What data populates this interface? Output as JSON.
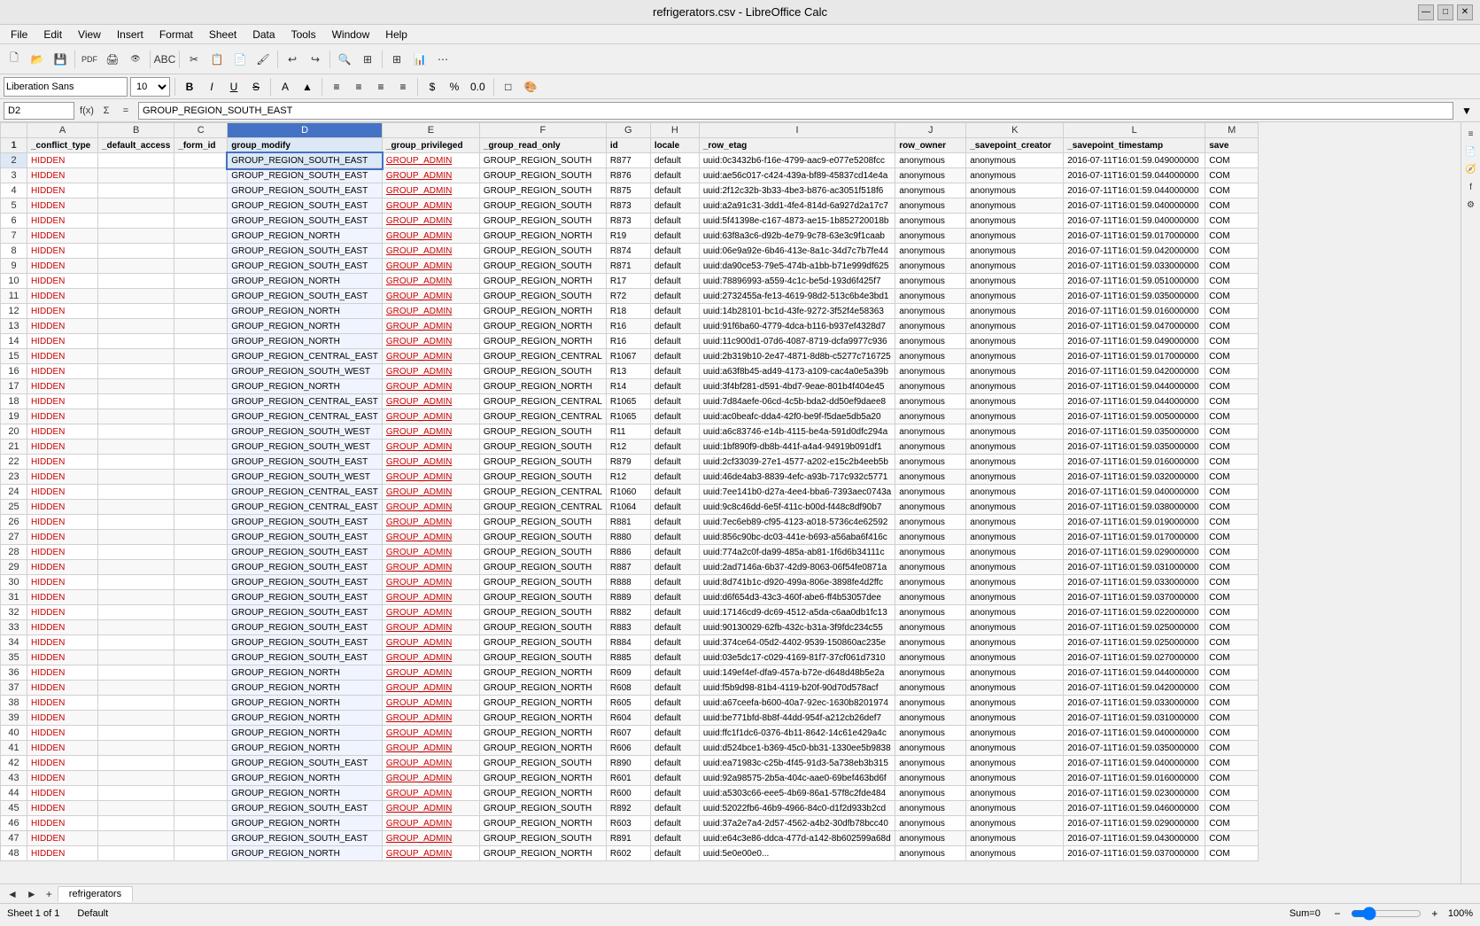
{
  "title": "refrigerators.csv - LibreOffice Calc",
  "titleBar": {
    "title": "refrigerators.csv - LibreOffice Calc",
    "minimizeLabel": "—",
    "maximizeLabel": "□",
    "closeLabel": "✕"
  },
  "menuBar": {
    "items": [
      "File",
      "Edit",
      "View",
      "Insert",
      "Format",
      "Sheet",
      "Data",
      "Tools",
      "Window",
      "Help"
    ]
  },
  "formatBar": {
    "fontName": "Liberation Sans",
    "fontSize": "10",
    "boldLabel": "B",
    "italicLabel": "I",
    "underlineLabel": "U"
  },
  "formulaBar": {
    "cellRef": "D2",
    "formula": "GROUP_REGION_SOUTH_EAST"
  },
  "columns": [
    {
      "id": "A",
      "label": "A",
      "header": "_conflict_type"
    },
    {
      "id": "B",
      "label": "B",
      "header": "_default_access"
    },
    {
      "id": "C",
      "label": "C",
      "header": "_form_id"
    },
    {
      "id": "D",
      "label": "D",
      "header": "group_modify"
    },
    {
      "id": "E",
      "label": "E",
      "header": "_group_privileged"
    },
    {
      "id": "F",
      "label": "F",
      "header": "_group_read_only"
    },
    {
      "id": "G",
      "label": "G",
      "header": "id"
    },
    {
      "id": "H",
      "label": "H",
      "header": "locale"
    },
    {
      "id": "I",
      "label": "I",
      "header": "_row_etag"
    },
    {
      "id": "J",
      "label": "J",
      "header": "row_owner"
    },
    {
      "id": "K",
      "label": "K",
      "header": "_savepoint_creator"
    },
    {
      "id": "L",
      "label": "L",
      "header": "_savepoint_timestamp"
    },
    {
      "id": "M",
      "label": "M",
      "header": "save"
    }
  ],
  "rows": [
    {
      "num": 2,
      "A": "HIDDEN",
      "B": "",
      "C": "",
      "D": "GROUP_REGION_SOUTH_EAST",
      "E": "GROUP_ADMIN",
      "F": "GROUP_REGION_SOUTH",
      "G": "R877",
      "H": "default",
      "I": "uuid:0c3432b6-f16e-4799-aac9-e077e5208fcc",
      "J": "anonymous",
      "K": "anonymous",
      "L": "2016-07-11T16:01:59.049000000",
      "M": "COM"
    },
    {
      "num": 3,
      "A": "HIDDEN",
      "B": "",
      "C": "",
      "D": "GROUP_REGION_SOUTH_EAST",
      "E": "GROUP_ADMIN",
      "F": "GROUP_REGION_SOUTH",
      "G": "R876",
      "H": "default",
      "I": "uuid:ae56c017-c424-439a-bf89-45837cd14e4a",
      "J": "anonymous",
      "K": "anonymous",
      "L": "2016-07-11T16:01:59.044000000",
      "M": "COM"
    },
    {
      "num": 4,
      "A": "HIDDEN",
      "B": "",
      "C": "",
      "D": "GROUP_REGION_SOUTH_EAST",
      "E": "GROUP_ADMIN",
      "F": "GROUP_REGION_SOUTH",
      "G": "R875",
      "H": "default",
      "I": "uuid:2f12c32b-3b33-4be3-b876-ac3051f518f6",
      "J": "anonymous",
      "K": "anonymous",
      "L": "2016-07-11T16:01:59.044000000",
      "M": "COM"
    },
    {
      "num": 5,
      "A": "HIDDEN",
      "B": "",
      "C": "",
      "D": "GROUP_REGION_SOUTH_EAST",
      "E": "GROUP_ADMIN",
      "F": "GROUP_REGION_SOUTH",
      "G": "R873",
      "H": "default",
      "I": "uuid:a2a91c31-3dd1-4fe4-814d-6a927d2a17c7",
      "J": "anonymous",
      "K": "anonymous",
      "L": "2016-07-11T16:01:59.040000000",
      "M": "COM"
    },
    {
      "num": 6,
      "A": "HIDDEN",
      "B": "",
      "C": "",
      "D": "GROUP_REGION_SOUTH_EAST",
      "E": "GROUP_ADMIN",
      "F": "GROUP_REGION_SOUTH",
      "G": "R873",
      "H": "default",
      "I": "uuid:5f41398e-c167-4873-ae15-1b852720018b",
      "J": "anonymous",
      "K": "anonymous",
      "L": "2016-07-11T16:01:59.040000000",
      "M": "COM"
    },
    {
      "num": 7,
      "A": "HIDDEN",
      "B": "",
      "C": "",
      "D": "GROUP_REGION_NORTH",
      "E": "GROUP_ADMIN",
      "F": "GROUP_REGION_NORTH",
      "G": "R19",
      "H": "default",
      "I": "uuid:63f8a3c6-d92b-4e79-9c78-63e3c9f1caab",
      "J": "anonymous",
      "K": "anonymous",
      "L": "2016-07-11T16:01:59.017000000",
      "M": "COM"
    },
    {
      "num": 8,
      "A": "HIDDEN",
      "B": "",
      "C": "",
      "D": "GROUP_REGION_SOUTH_EAST",
      "E": "GROUP_ADMIN",
      "F": "GROUP_REGION_SOUTH",
      "G": "R874",
      "H": "default",
      "I": "uuid:06e9a92e-6b46-413e-8a1c-34d7c7b7fe44",
      "J": "anonymous",
      "K": "anonymous",
      "L": "2016-07-11T16:01:59.042000000",
      "M": "COM"
    },
    {
      "num": 9,
      "A": "HIDDEN",
      "B": "",
      "C": "",
      "D": "GROUP_REGION_SOUTH_EAST",
      "E": "GROUP_ADMIN",
      "F": "GROUP_REGION_SOUTH",
      "G": "R871",
      "H": "default",
      "I": "uuid:da90ce53-79e5-474b-a1bb-b71e999df625",
      "J": "anonymous",
      "K": "anonymous",
      "L": "2016-07-11T16:01:59.033000000",
      "M": "COM"
    },
    {
      "num": 10,
      "A": "HIDDEN",
      "B": "",
      "C": "",
      "D": "GROUP_REGION_NORTH",
      "E": "GROUP_ADMIN",
      "F": "GROUP_REGION_NORTH",
      "G": "R17",
      "H": "default",
      "I": "uuid:78896993-a559-4c1c-be5d-193d6f425f7",
      "J": "anonymous",
      "K": "anonymous",
      "L": "2016-07-11T16:01:59.051000000",
      "M": "COM"
    },
    {
      "num": 11,
      "A": "HIDDEN",
      "B": "",
      "C": "",
      "D": "GROUP_REGION_SOUTH_EAST",
      "E": "GROUP_ADMIN",
      "F": "GROUP_REGION_SOUTH",
      "G": "R72",
      "H": "default",
      "I": "uuid:2732455a-fe13-4619-98d2-513c6b4e3bd1",
      "J": "anonymous",
      "K": "anonymous",
      "L": "2016-07-11T16:01:59.035000000",
      "M": "COM"
    },
    {
      "num": 12,
      "A": "HIDDEN",
      "B": "",
      "C": "",
      "D": "GROUP_REGION_NORTH",
      "E": "GROUP_ADMIN",
      "F": "GROUP_REGION_NORTH",
      "G": "R18",
      "H": "default",
      "I": "uuid:14b28101-bc1d-43fe-9272-3f52f4e58363",
      "J": "anonymous",
      "K": "anonymous",
      "L": "2016-07-11T16:01:59.016000000",
      "M": "COM"
    },
    {
      "num": 13,
      "A": "HIDDEN",
      "B": "",
      "C": "",
      "D": "GROUP_REGION_NORTH",
      "E": "GROUP_ADMIN",
      "F": "GROUP_REGION_NORTH",
      "G": "R16",
      "H": "default",
      "I": "uuid:91f6ba60-4779-4dca-b116-b937ef4328d7",
      "J": "anonymous",
      "K": "anonymous",
      "L": "2016-07-11T16:01:59.047000000",
      "M": "COM"
    },
    {
      "num": 14,
      "A": "HIDDEN",
      "B": "",
      "C": "",
      "D": "GROUP_REGION_NORTH",
      "E": "GROUP_ADMIN",
      "F": "GROUP_REGION_NORTH",
      "G": "R16",
      "H": "default",
      "I": "uuid:11c900d1-07d6-4087-8719-dcfa9977c936",
      "J": "anonymous",
      "K": "anonymous",
      "L": "2016-07-11T16:01:59.049000000",
      "M": "COM"
    },
    {
      "num": 15,
      "A": "HIDDEN",
      "B": "",
      "C": "",
      "D": "GROUP_REGION_CENTRAL_EAST",
      "E": "GROUP_ADMIN",
      "F": "GROUP_REGION_CENTRAL",
      "G": "R1067",
      "H": "default",
      "I": "uuid:2b319b10-2e47-4871-8d8b-c5277c716725",
      "J": "anonymous",
      "K": "anonymous",
      "L": "2016-07-11T16:01:59.017000000",
      "M": "COM"
    },
    {
      "num": 16,
      "A": "HIDDEN",
      "B": "",
      "C": "",
      "D": "GROUP_REGION_SOUTH_WEST",
      "E": "GROUP_ADMIN",
      "F": "GROUP_REGION_SOUTH",
      "G": "R13",
      "H": "default",
      "I": "uuid:a63f8b45-ad49-4173-a109-cac4a0e5a39b",
      "J": "anonymous",
      "K": "anonymous",
      "L": "2016-07-11T16:01:59.042000000",
      "M": "COM"
    },
    {
      "num": 17,
      "A": "HIDDEN",
      "B": "",
      "C": "",
      "D": "GROUP_REGION_NORTH",
      "E": "GROUP_ADMIN",
      "F": "GROUP_REGION_NORTH",
      "G": "R14",
      "H": "default",
      "I": "uuid:3f4bf281-d591-4bd7-9eae-801b4f404e45",
      "J": "anonymous",
      "K": "anonymous",
      "L": "2016-07-11T16:01:59.044000000",
      "M": "COM"
    },
    {
      "num": 18,
      "A": "HIDDEN",
      "B": "",
      "C": "",
      "D": "GROUP_REGION_CENTRAL_EAST",
      "E": "GROUP_ADMIN",
      "F": "GROUP_REGION_CENTRAL",
      "G": "R1065",
      "H": "default",
      "I": "uuid:7d84aefe-06cd-4c5b-bda2-dd50ef9daee8",
      "J": "anonymous",
      "K": "anonymous",
      "L": "2016-07-11T16:01:59.044000000",
      "M": "COM"
    },
    {
      "num": 19,
      "A": "HIDDEN",
      "B": "",
      "C": "",
      "D": "GROUP_REGION_CENTRAL_EAST",
      "E": "GROUP_ADMIN",
      "F": "GROUP_REGION_CENTRAL",
      "G": "R1065",
      "H": "default",
      "I": "uuid:ac0beafc-dda4-42f0-be9f-f5dae5db5a20",
      "J": "anonymous",
      "K": "anonymous",
      "L": "2016-07-11T16:01:59.005000000",
      "M": "COM"
    },
    {
      "num": 20,
      "A": "HIDDEN",
      "B": "",
      "C": "",
      "D": "GROUP_REGION_SOUTH_WEST",
      "E": "GROUP_ADMIN",
      "F": "GROUP_REGION_SOUTH",
      "G": "R11",
      "H": "default",
      "I": "uuid:a6c83746-e14b-4115-be4a-591d0dfc294a",
      "J": "anonymous",
      "K": "anonymous",
      "L": "2016-07-11T16:01:59.035000000",
      "M": "COM"
    },
    {
      "num": 21,
      "A": "HIDDEN",
      "B": "",
      "C": "",
      "D": "GROUP_REGION_SOUTH_WEST",
      "E": "GROUP_ADMIN",
      "F": "GROUP_REGION_SOUTH",
      "G": "R12",
      "H": "default",
      "I": "uuid:1bf890f9-db8b-441f-a4a4-94919b091df1",
      "J": "anonymous",
      "K": "anonymous",
      "L": "2016-07-11T16:01:59.035000000",
      "M": "COM"
    },
    {
      "num": 22,
      "A": "HIDDEN",
      "B": "",
      "C": "",
      "D": "GROUP_REGION_SOUTH_EAST",
      "E": "GROUP_ADMIN",
      "F": "GROUP_REGION_SOUTH",
      "G": "R879",
      "H": "default",
      "I": "uuid:2cf33039-27e1-4577-a202-e15c2b4eeb5b",
      "J": "anonymous",
      "K": "anonymous",
      "L": "2016-07-11T16:01:59.016000000",
      "M": "COM"
    },
    {
      "num": 23,
      "A": "HIDDEN",
      "B": "",
      "C": "",
      "D": "GROUP_REGION_SOUTH_WEST",
      "E": "GROUP_ADMIN",
      "F": "GROUP_REGION_SOUTH",
      "G": "R12",
      "H": "default",
      "I": "uuid:46de4ab3-8839-4efc-a93b-717c932c5771",
      "J": "anonymous",
      "K": "anonymous",
      "L": "2016-07-11T16:01:59.032000000",
      "M": "COM"
    },
    {
      "num": 24,
      "A": "HIDDEN",
      "B": "",
      "C": "",
      "D": "GROUP_REGION_CENTRAL_EAST",
      "E": "GROUP_ADMIN",
      "F": "GROUP_REGION_CENTRAL",
      "G": "R1060",
      "H": "default",
      "I": "uuid:7ee141b0-d27a-4ee4-bba6-7393aec0743a",
      "J": "anonymous",
      "K": "anonymous",
      "L": "2016-07-11T16:01:59.040000000",
      "M": "COM"
    },
    {
      "num": 25,
      "A": "HIDDEN",
      "B": "",
      "C": "",
      "D": "GROUP_REGION_CENTRAL_EAST",
      "E": "GROUP_ADMIN",
      "F": "GROUP_REGION_CENTRAL",
      "G": "R1064",
      "H": "default",
      "I": "uuid:9c8c46dd-6e5f-411c-b00d-f448c8df90b7",
      "J": "anonymous",
      "K": "anonymous",
      "L": "2016-07-11T16:01:59.038000000",
      "M": "COM"
    },
    {
      "num": 26,
      "A": "HIDDEN",
      "B": "",
      "C": "",
      "D": "GROUP_REGION_SOUTH_EAST",
      "E": "GROUP_ADMIN",
      "F": "GROUP_REGION_SOUTH",
      "G": "R881",
      "H": "default",
      "I": "uuid:7ec6eb89-cf95-4123-a018-5736c4e62592",
      "J": "anonymous",
      "K": "anonymous",
      "L": "2016-07-11T16:01:59.019000000",
      "M": "COM"
    },
    {
      "num": 27,
      "A": "HIDDEN",
      "B": "",
      "C": "",
      "D": "GROUP_REGION_SOUTH_EAST",
      "E": "GROUP_ADMIN",
      "F": "GROUP_REGION_SOUTH",
      "G": "R880",
      "H": "default",
      "I": "uuid:856c90bc-dc03-441e-b693-a56aba6f416c",
      "J": "anonymous",
      "K": "anonymous",
      "L": "2016-07-11T16:01:59.017000000",
      "M": "COM"
    },
    {
      "num": 28,
      "A": "HIDDEN",
      "B": "",
      "C": "",
      "D": "GROUP_REGION_SOUTH_EAST",
      "E": "GROUP_ADMIN",
      "F": "GROUP_REGION_SOUTH",
      "G": "R886",
      "H": "default",
      "I": "uuid:774a2c0f-da99-485a-ab81-1f6d6b34111c",
      "J": "anonymous",
      "K": "anonymous",
      "L": "2016-07-11T16:01:59.029000000",
      "M": "COM"
    },
    {
      "num": 29,
      "A": "HIDDEN",
      "B": "",
      "C": "",
      "D": "GROUP_REGION_SOUTH_EAST",
      "E": "GROUP_ADMIN",
      "F": "GROUP_REGION_SOUTH",
      "G": "R887",
      "H": "default",
      "I": "uuid:2ad7146a-6b37-42d9-8063-06f54fe0871a",
      "J": "anonymous",
      "K": "anonymous",
      "L": "2016-07-11T16:01:59.031000000",
      "M": "COM"
    },
    {
      "num": 30,
      "A": "HIDDEN",
      "B": "",
      "C": "",
      "D": "GROUP_REGION_SOUTH_EAST",
      "E": "GROUP_ADMIN",
      "F": "GROUP_REGION_SOUTH",
      "G": "R888",
      "H": "default",
      "I": "uuid:8d741b1c-d920-499a-806e-3898fe4d2ffc",
      "J": "anonymous",
      "K": "anonymous",
      "L": "2016-07-11T16:01:59.033000000",
      "M": "COM"
    },
    {
      "num": 31,
      "A": "HIDDEN",
      "B": "",
      "C": "",
      "D": "GROUP_REGION_SOUTH_EAST",
      "E": "GROUP_ADMIN",
      "F": "GROUP_REGION_SOUTH",
      "G": "R889",
      "H": "default",
      "I": "uuid:d6f654d3-43c3-460f-abe6-ff4b53057dee",
      "J": "anonymous",
      "K": "anonymous",
      "L": "2016-07-11T16:01:59.037000000",
      "M": "COM"
    },
    {
      "num": 32,
      "A": "HIDDEN",
      "B": "",
      "C": "",
      "D": "GROUP_REGION_SOUTH_EAST",
      "E": "GROUP_ADMIN",
      "F": "GROUP_REGION_SOUTH",
      "G": "R882",
      "H": "default",
      "I": "uuid:17146cd9-dc69-4512-a5da-c6aa0db1fc13",
      "J": "anonymous",
      "K": "anonymous",
      "L": "2016-07-11T16:01:59.022000000",
      "M": "COM"
    },
    {
      "num": 33,
      "A": "HIDDEN",
      "B": "",
      "C": "",
      "D": "GROUP_REGION_SOUTH_EAST",
      "E": "GROUP_ADMIN",
      "F": "GROUP_REGION_SOUTH",
      "G": "R883",
      "H": "default",
      "I": "uuid:90130029-62fb-432c-b31a-3f9fdc234c55",
      "J": "anonymous",
      "K": "anonymous",
      "L": "2016-07-11T16:01:59.025000000",
      "M": "COM"
    },
    {
      "num": 34,
      "A": "HIDDEN",
      "B": "",
      "C": "",
      "D": "GROUP_REGION_SOUTH_EAST",
      "E": "GROUP_ADMIN",
      "F": "GROUP_REGION_SOUTH",
      "G": "R884",
      "H": "default",
      "I": "uuid:374ce64-05d2-4402-9539-150860ac235e",
      "J": "anonymous",
      "K": "anonymous",
      "L": "2016-07-11T16:01:59.025000000",
      "M": "COM"
    },
    {
      "num": 35,
      "A": "HIDDEN",
      "B": "",
      "C": "",
      "D": "GROUP_REGION_SOUTH_EAST",
      "E": "GROUP_ADMIN",
      "F": "GROUP_REGION_SOUTH",
      "G": "R885",
      "H": "default",
      "I": "uuid:03e5dc17-c029-4169-81f7-37cf061d7310",
      "J": "anonymous",
      "K": "anonymous",
      "L": "2016-07-11T16:01:59.027000000",
      "M": "COM"
    },
    {
      "num": 36,
      "A": "HIDDEN",
      "B": "",
      "C": "",
      "D": "GROUP_REGION_NORTH",
      "E": "GROUP_ADMIN",
      "F": "GROUP_REGION_NORTH",
      "G": "R609",
      "H": "default",
      "I": "uuid:149ef4ef-dfa9-457a-b72e-d648d48b5e2a",
      "J": "anonymous",
      "K": "anonymous",
      "L": "2016-07-11T16:01:59.044000000",
      "M": "COM"
    },
    {
      "num": 37,
      "A": "HIDDEN",
      "B": "",
      "C": "",
      "D": "GROUP_REGION_NORTH",
      "E": "GROUP_ADMIN",
      "F": "GROUP_REGION_NORTH",
      "G": "R608",
      "H": "default",
      "I": "uuid:f5b9d98-81b4-4119-b20f-90d70d578acf",
      "J": "anonymous",
      "K": "anonymous",
      "L": "2016-07-11T16:01:59.042000000",
      "M": "COM"
    },
    {
      "num": 38,
      "A": "HIDDEN",
      "B": "",
      "C": "",
      "D": "GROUP_REGION_NORTH",
      "E": "GROUP_ADMIN",
      "F": "GROUP_REGION_NORTH",
      "G": "R605",
      "H": "default",
      "I": "uuid:a67ceefa-b600-40a7-92ec-1630b8201974",
      "J": "anonymous",
      "K": "anonymous",
      "L": "2016-07-11T16:01:59.033000000",
      "M": "COM"
    },
    {
      "num": 39,
      "A": "HIDDEN",
      "B": "",
      "C": "",
      "D": "GROUP_REGION_NORTH",
      "E": "GROUP_ADMIN",
      "F": "GROUP_REGION_NORTH",
      "G": "R604",
      "H": "default",
      "I": "uuid:be771bfd-8b8f-44dd-954f-a212cb26def7",
      "J": "anonymous",
      "K": "anonymous",
      "L": "2016-07-11T16:01:59.031000000",
      "M": "COM"
    },
    {
      "num": 40,
      "A": "HIDDEN",
      "B": "",
      "C": "",
      "D": "GROUP_REGION_NORTH",
      "E": "GROUP_ADMIN",
      "F": "GROUP_REGION_NORTH",
      "G": "R607",
      "H": "default",
      "I": "uuid:ffc1f1dc6-0376-4b11-8642-14c61e429a4c",
      "J": "anonymous",
      "K": "anonymous",
      "L": "2016-07-11T16:01:59.040000000",
      "M": "COM"
    },
    {
      "num": 41,
      "A": "HIDDEN",
      "B": "",
      "C": "",
      "D": "GROUP_REGION_NORTH",
      "E": "GROUP_ADMIN",
      "F": "GROUP_REGION_NORTH",
      "G": "R606",
      "H": "default",
      "I": "uuid:d524bce1-b369-45c0-bb31-1330ee5b9838",
      "J": "anonymous",
      "K": "anonymous",
      "L": "2016-07-11T16:01:59.035000000",
      "M": "COM"
    },
    {
      "num": 42,
      "A": "HIDDEN",
      "B": "",
      "C": "",
      "D": "GROUP_REGION_SOUTH_EAST",
      "E": "GROUP_ADMIN",
      "F": "GROUP_REGION_SOUTH",
      "G": "R890",
      "H": "default",
      "I": "uuid:ea71983c-c25b-4f45-91d3-5a738eb3b315",
      "J": "anonymous",
      "K": "anonymous",
      "L": "2016-07-11T16:01:59.040000000",
      "M": "COM"
    },
    {
      "num": 43,
      "A": "HIDDEN",
      "B": "",
      "C": "",
      "D": "GROUP_REGION_NORTH",
      "E": "GROUP_ADMIN",
      "F": "GROUP_REGION_NORTH",
      "G": "R601",
      "H": "default",
      "I": "uuid:92a98575-2b5a-404c-aae0-69bef463bd6f",
      "J": "anonymous",
      "K": "anonymous",
      "L": "2016-07-11T16:01:59.016000000",
      "M": "COM"
    },
    {
      "num": 44,
      "A": "HIDDEN",
      "B": "",
      "C": "",
      "D": "GROUP_REGION_NORTH",
      "E": "GROUP_ADMIN",
      "F": "GROUP_REGION_NORTH",
      "G": "R600",
      "H": "default",
      "I": "uuid:a5303c66-eee5-4b69-86a1-57f8c2fde484",
      "J": "anonymous",
      "K": "anonymous",
      "L": "2016-07-11T16:01:59.023000000",
      "M": "COM"
    },
    {
      "num": 45,
      "A": "HIDDEN",
      "B": "",
      "C": "",
      "D": "GROUP_REGION_SOUTH_EAST",
      "E": "GROUP_ADMIN",
      "F": "GROUP_REGION_SOUTH",
      "G": "R892",
      "H": "default",
      "I": "uuid:52022fb6-46b9-4966-84c0-d1f2d933b2cd",
      "J": "anonymous",
      "K": "anonymous",
      "L": "2016-07-11T16:01:59.046000000",
      "M": "COM"
    },
    {
      "num": 46,
      "A": "HIDDEN",
      "B": "",
      "C": "",
      "D": "GROUP_REGION_NORTH",
      "E": "GROUP_ADMIN",
      "F": "GROUP_REGION_NORTH",
      "G": "R603",
      "H": "default",
      "I": "uuid:37a2e7a4-2d57-4562-a4b2-30dfb78bcc40",
      "J": "anonymous",
      "K": "anonymous",
      "L": "2016-07-11T16:01:59.029000000",
      "M": "COM"
    },
    {
      "num": 47,
      "A": "HIDDEN",
      "B": "",
      "C": "",
      "D": "GROUP_REGION_SOUTH_EAST",
      "E": "GROUP_ADMIN",
      "F": "GROUP_REGION_SOUTH",
      "G": "R891",
      "H": "default",
      "I": "uuid:e64c3e86-ddca-477d-a142-8b602599a68d",
      "J": "anonymous",
      "K": "anonymous",
      "L": "2016-07-11T16:01:59.043000000",
      "M": "COM"
    },
    {
      "num": 48,
      "A": "HIDDEN",
      "B": "",
      "C": "",
      "D": "GROUP_REGION_NORTH",
      "E": "GROUP_ADMIN",
      "F": "GROUP_REGION_NORTH",
      "G": "R602",
      "H": "default",
      "I": "uuid:5e0e00e0...",
      "J": "anonymous",
      "K": "anonymous",
      "L": "2016-07-11T16:01:59.037000000",
      "M": "COM"
    }
  ],
  "statusBar": {
    "sheetInfo": "Sheet 1 of 1",
    "style": "Default",
    "sum": "Sum=0",
    "zoom": "100%"
  },
  "sheetTabs": {
    "tabs": [
      "refrigerators"
    ],
    "activeTab": "refrigerators"
  }
}
